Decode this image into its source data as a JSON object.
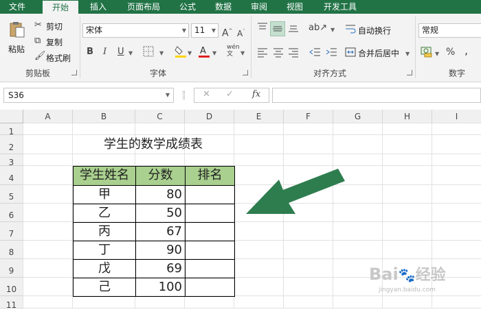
{
  "ribbon_tabs": [
    "文件",
    "开始",
    "插入",
    "页面布局",
    "公式",
    "数据",
    "审阅",
    "视图",
    "开发工具"
  ],
  "clipboard": {
    "paste": "粘贴",
    "cut": "剪切",
    "copy": "复制",
    "format_painter": "格式刷",
    "group_label": "剪贴板"
  },
  "font": {
    "name": "宋体",
    "size": "11",
    "bold": "B",
    "italic": "I",
    "underline": "U",
    "phonetic": "wén",
    "group_label": "字体"
  },
  "alignment": {
    "wrap_text": "自动换行",
    "merge_center": "合并后居中",
    "group_label": "对齐方式"
  },
  "number": {
    "format": "常规",
    "percent": "%",
    "group_label": "数字"
  },
  "formula_bar": {
    "name_box": "S36",
    "cancel": "✕",
    "enter": "✓",
    "fx": "fx",
    "value": ""
  },
  "columns": [
    "A",
    "B",
    "C",
    "D",
    "E",
    "F",
    "G",
    "H",
    "I"
  ],
  "rows": [
    "1",
    "2",
    "3",
    "4",
    "5",
    "6",
    "7",
    "8",
    "9",
    "10",
    "11"
  ],
  "sheet": {
    "title": "学生的数学成绩表",
    "headers": [
      "学生姓名",
      "分数",
      "排名"
    ],
    "records": [
      {
        "name": "甲",
        "score": "80",
        "rank": ""
      },
      {
        "name": "乙",
        "score": "50",
        "rank": ""
      },
      {
        "name": "丙",
        "score": "67",
        "rank": ""
      },
      {
        "name": "丁",
        "score": "90",
        "rank": ""
      },
      {
        "name": "戊",
        "score": "69",
        "rank": ""
      },
      {
        "name": "己",
        "score": "100",
        "rank": ""
      }
    ]
  },
  "watermark": {
    "brand": "Bai",
    "paw": "du",
    "cn": "经验",
    "url": "jingyan.baidu.com"
  },
  "colors": {
    "excel_green": "#217346",
    "header_fill": "#a9d08e",
    "arrow": "#2e7d4f"
  },
  "icons": [
    "scissors-icon",
    "copy-icon",
    "paintbrush-icon",
    "paste-icon",
    "fill-color-icon",
    "font-color-icon",
    "border-icon",
    "orientation-icon",
    "indent-icon",
    "wrap-icon",
    "merge-icon",
    "arrow-pointer"
  ]
}
